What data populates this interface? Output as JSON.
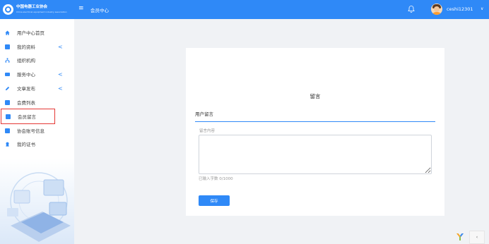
{
  "header": {
    "logo_cn": "中国电器工业协会",
    "logo_en": "China electrical equipment industry association",
    "menu_icon": "hamburger-icon",
    "nav_label": "会员中心",
    "bell_icon": "bell-icon",
    "username": "ceshi12301",
    "caret": "∨",
    "accent": "#2f89f7"
  },
  "sidebar": {
    "items": [
      {
        "label": "用户中心首页",
        "icon": "home-icon",
        "has_caret": false
      },
      {
        "label": "我的资料",
        "icon": "profile-icon",
        "has_caret": true
      },
      {
        "label": "组织机构",
        "icon": "org-icon",
        "has_caret": false
      },
      {
        "label": "服务中心",
        "icon": "service-icon",
        "has_caret": true
      },
      {
        "label": "文章发布",
        "icon": "pen-icon",
        "has_caret": true
      },
      {
        "label": "会费列表",
        "icon": "document-icon",
        "has_caret": false
      },
      {
        "label": "会员留言",
        "icon": "document-icon",
        "has_caret": false,
        "active": true
      },
      {
        "label": "协会账号信息",
        "icon": "document-icon",
        "has_caret": false
      },
      {
        "label": "我的证书",
        "icon": "certificate-icon",
        "has_caret": false
      }
    ],
    "caret": "<"
  },
  "main": {
    "title": "留言",
    "section_label": "用户留言",
    "field_label": "留言内容",
    "textarea_value": "",
    "counter": "已输入字数 0/1000",
    "save_label": "保存"
  },
  "widget": {
    "arrow": "‹"
  }
}
